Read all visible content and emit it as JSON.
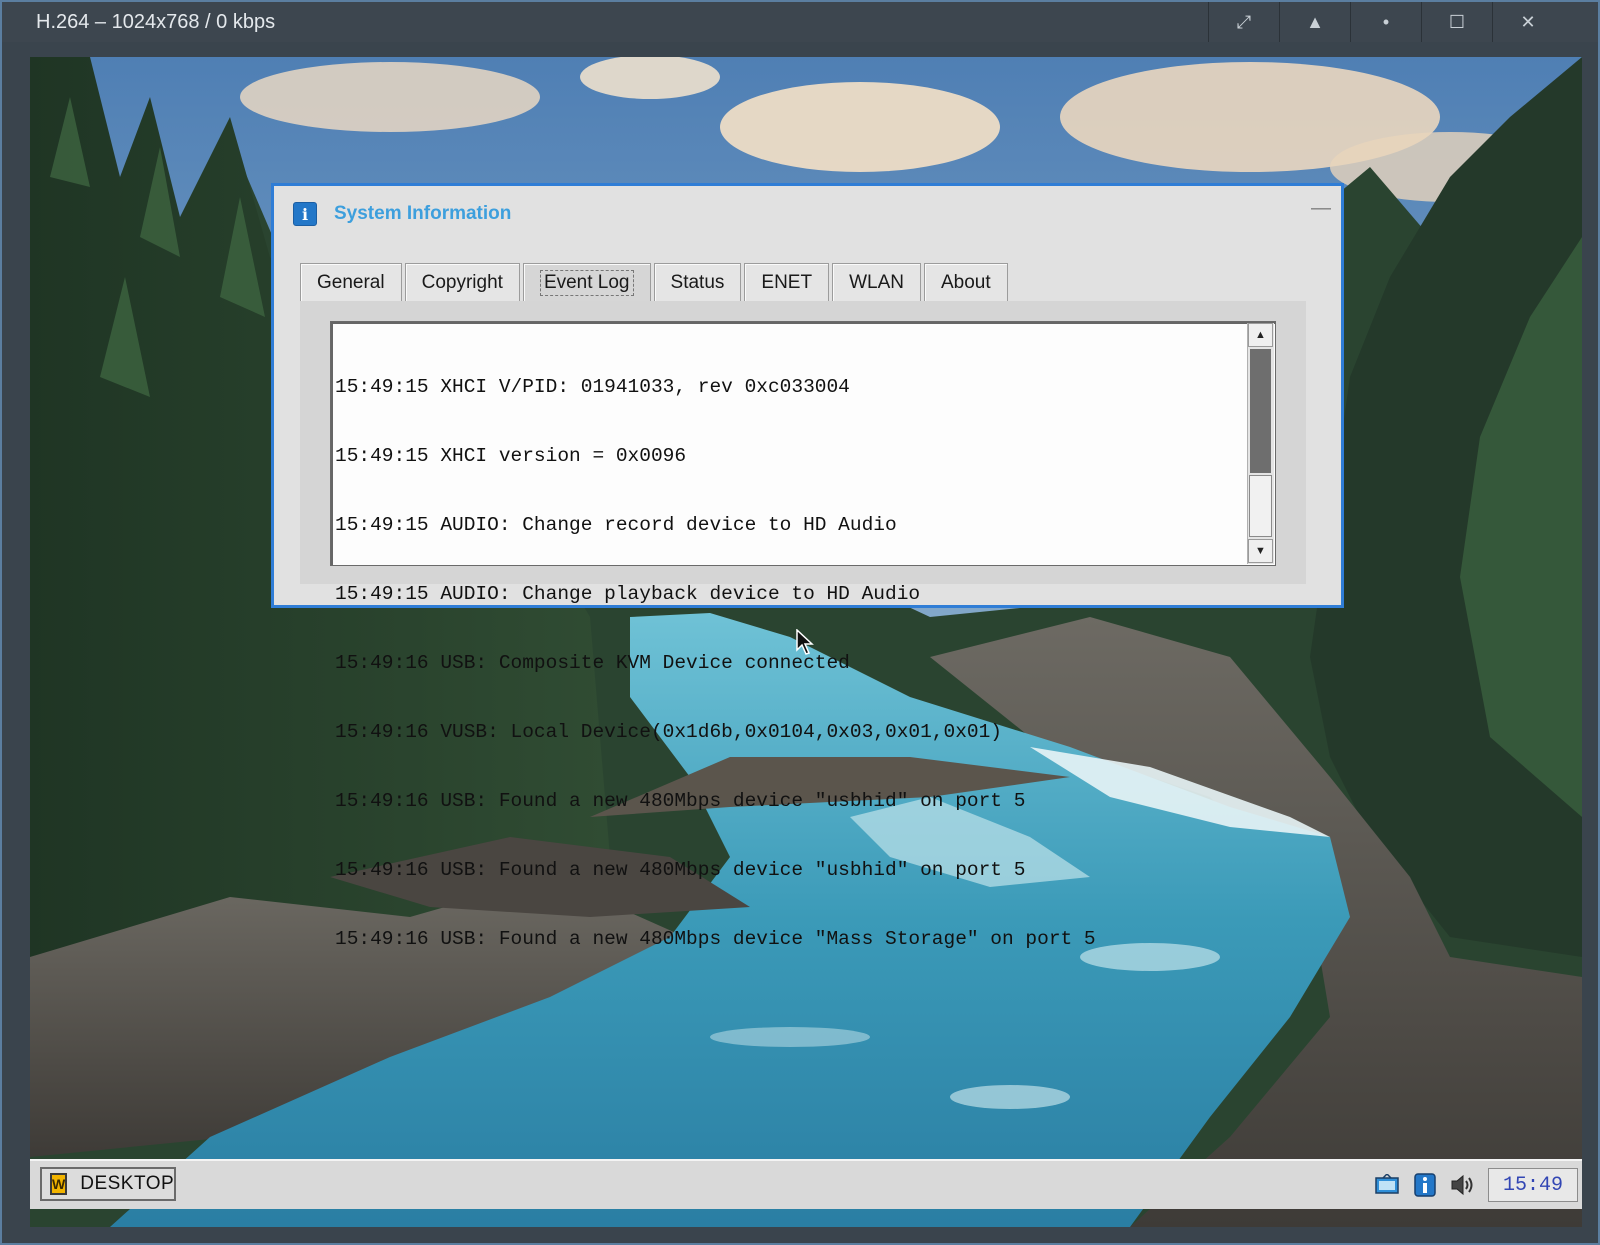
{
  "viewer": {
    "title": "H.264 – 1024x768 / 0 kbps",
    "controls": [
      "expand-icon",
      "eject-icon",
      "dot-icon",
      "maximize-icon",
      "close-icon"
    ]
  },
  "dialog": {
    "title": "System Information",
    "title_color": "#3d9fdd",
    "border_color": "#2f7dd6",
    "minimize_glyph": "—",
    "tabs": [
      {
        "label": "General",
        "active": false
      },
      {
        "label": "Copyright",
        "active": false
      },
      {
        "label": "Event Log",
        "active": true
      },
      {
        "label": "Status",
        "active": false
      },
      {
        "label": "ENET",
        "active": false
      },
      {
        "label": "WLAN",
        "active": false
      },
      {
        "label": "About",
        "active": false
      }
    ],
    "event_log": [
      "15:49:15 XHCI V/PID: 01941033, rev 0xc033004",
      "15:49:15 XHCI version = 0x0096",
      "15:49:15 AUDIO: Change record device to HD Audio",
      "15:49:15 AUDIO: Change playback device to HD Audio",
      "15:49:16 USB: Composite KVM Device connected",
      "15:49:16 VUSB: Local Device(0x1d6b,0x0104,0x03,0x01,0x01)",
      "15:49:16 USB: Found a new 480Mbps device \"usbhid\" on port 5",
      "15:49:16 USB: Found a new 480Mbps device \"usbhid\" on port 5",
      "15:49:16 USB: Found a new 480Mbps device \"Mass Storage\" on port 5"
    ]
  },
  "taskbar": {
    "start_label": "DESKTOP",
    "tray_icons": [
      "monitor-icon",
      "info-icon",
      "speaker-icon"
    ],
    "clock": "15:49",
    "clock_color": "#3246b4"
  }
}
